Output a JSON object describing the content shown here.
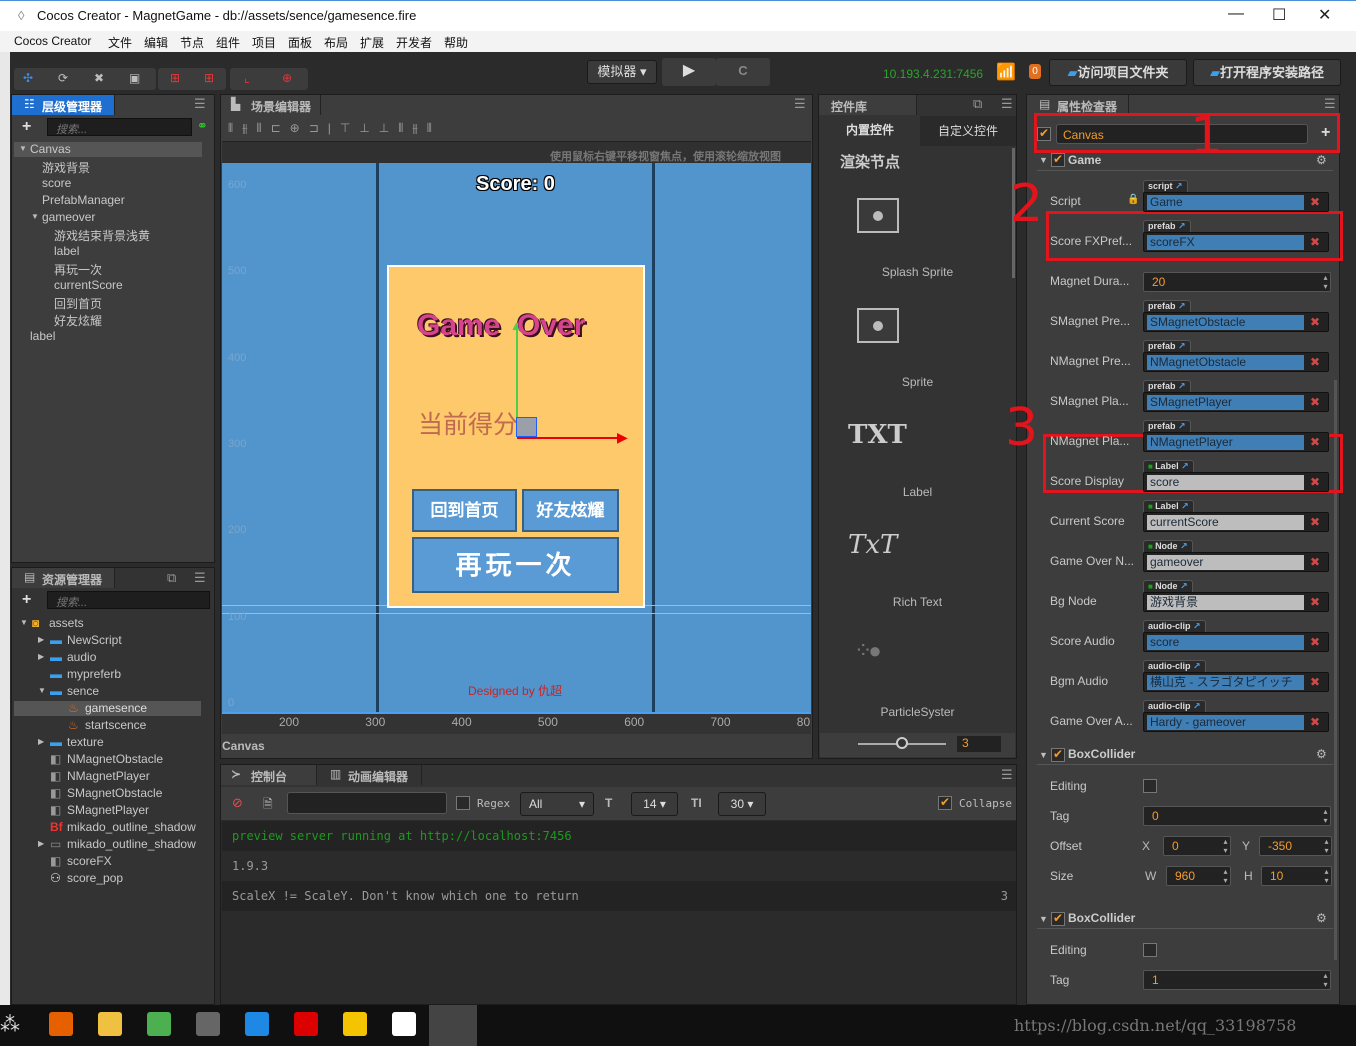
{
  "window": {
    "title": "Cocos Creator - MagnetGame - db://assets/sence/gamesence.fire",
    "minimize": "—",
    "maximize": "☐",
    "close": "✕"
  },
  "menu": [
    "Cocos Creator",
    "文件",
    "编辑",
    "节点",
    "组件",
    "项目",
    "面板",
    "布局",
    "扩展",
    "开发者",
    "帮助"
  ],
  "toolbar": {
    "simulator": "模拟器 ▾",
    "play": "▶",
    "refresh": "C",
    "ip": "10.193.4.231:7456",
    "badge": "0",
    "open_project": "访问项目文件夹",
    "open_install": "打开程序安装路径"
  },
  "hierarchy": {
    "title": "层级管理器",
    "search_placeholder": "搜索...",
    "items": [
      {
        "label": "Canvas",
        "depth": 0,
        "expanded": true
      },
      {
        "label": "游戏背景",
        "depth": 1
      },
      {
        "label": "score",
        "depth": 1
      },
      {
        "label": "PrefabManager",
        "depth": 1
      },
      {
        "label": "gameover",
        "depth": 1,
        "expanded": true
      },
      {
        "label": "游戏结束背景浅黄",
        "depth": 2
      },
      {
        "label": "label",
        "depth": 2
      },
      {
        "label": "再玩一次",
        "depth": 2
      },
      {
        "label": "currentScore",
        "depth": 2
      },
      {
        "label": "回到首页",
        "depth": 2
      },
      {
        "label": "好友炫耀",
        "depth": 2
      },
      {
        "label": "label",
        "depth": 0
      }
    ]
  },
  "assets": {
    "title": "资源管理器",
    "search_placeholder": "搜索...",
    "items": [
      {
        "label": "assets",
        "depth": 0,
        "icon": "assets-db-icon",
        "arrow": "down"
      },
      {
        "label": "NewScript",
        "depth": 1,
        "icon": "folder-icon",
        "arrow": "right"
      },
      {
        "label": "audio",
        "depth": 1,
        "icon": "folder-icon",
        "arrow": "right"
      },
      {
        "label": "mypreferb",
        "depth": 1,
        "icon": "folder-icon"
      },
      {
        "label": "sence",
        "depth": 1,
        "icon": "folder-icon",
        "arrow": "down"
      },
      {
        "label": "gamesence",
        "depth": 2,
        "icon": "scene-fire-icon",
        "selected": true
      },
      {
        "label": "startscence",
        "depth": 2,
        "icon": "scene-fire-icon"
      },
      {
        "label": "texture",
        "depth": 1,
        "icon": "folder-icon",
        "arrow": "right"
      },
      {
        "label": "NMagnetObstacle",
        "depth": 1,
        "icon": "prefab-icon"
      },
      {
        "label": "NMagnetPlayer",
        "depth": 1,
        "icon": "prefab-icon"
      },
      {
        "label": "SMagnetObstacle",
        "depth": 1,
        "icon": "prefab-icon"
      },
      {
        "label": "SMagnetPlayer",
        "depth": 1,
        "icon": "prefab-icon"
      },
      {
        "label": "mikado_outline_shadow",
        "depth": 1,
        "icon": "bitmap-font-icon"
      },
      {
        "label": "mikado_outline_shadow",
        "depth": 1,
        "icon": "texture-icon",
        "arrow": "right"
      },
      {
        "label": "scoreFX",
        "depth": 1,
        "icon": "prefab-icon"
      },
      {
        "label": "score_pop",
        "depth": 1,
        "icon": "animation-clip-icon"
      }
    ]
  },
  "scene": {
    "title": "场景编辑器",
    "hint": "使用鼠标右键平移视窗焦点，使用滚轮缩放视图",
    "score_text": "Score: 0",
    "game_over": "Game  Over",
    "current_score": "当前得分 :",
    "btn_home": "回到首页",
    "btn_share": "好友炫耀",
    "btn_replay": "再玩一次",
    "designed_by": "Designed by 仇超",
    "y_ticks": [
      "600",
      "500",
      "400",
      "300",
      "200",
      "100",
      "0"
    ],
    "x_ticks": [
      "200",
      "300",
      "400",
      "500",
      "600",
      "700",
      "80"
    ],
    "footer": "Canvas",
    "bg_color": "#5294cc",
    "panel_color": "#fdc96a"
  },
  "widgets": {
    "title": "控件库",
    "tab_builtin": "内置控件",
    "tab_custom": "自定义控件",
    "section": "渲染节点",
    "items": [
      "Splash Sprite",
      "Sprite",
      "Label",
      "Rich Text",
      "ParticleSyster"
    ],
    "label_glyph": "TXT",
    "richtext_glyph": "TxT",
    "zoom_value": "3",
    "zoom_fraction": 0.5
  },
  "console": {
    "tab_console": "控制台",
    "tab_anim": "动画编辑器",
    "regex": "Regex",
    "level": "All",
    "font_size": "14",
    "line_height": "30",
    "collapse": "Collapse",
    "collapse_checked": true,
    "lines": [
      {
        "text": "preview server running at http://localhost:7456",
        "color": "#1d9a1d"
      },
      {
        "text": "1.9.3"
      },
      {
        "text": "ScaleX != ScaleY. Don't know which one to return",
        "count": "3"
      }
    ]
  },
  "inspector": {
    "title": "属性检查器",
    "node_name": "Canvas",
    "component": "Game",
    "props": [
      {
        "label": "Script",
        "tag": "script",
        "value": "Game",
        "kind": "blue",
        "lock": true
      },
      {
        "label": "Score FXPref...",
        "tag": "prefab",
        "value": "scoreFX",
        "kind": "blue"
      },
      {
        "label": "Magnet Dura...",
        "value": "20",
        "kind": "number"
      },
      {
        "label": "SMagnet Pre...",
        "tag": "prefab",
        "value": "SMagnetObstacle",
        "kind": "blue"
      },
      {
        "label": "NMagnet Pre...",
        "tag": "prefab",
        "value": "NMagnetObstacle",
        "kind": "blue"
      },
      {
        "label": "SMagnet Pla...",
        "tag": "prefab",
        "value": "SMagnetPlayer",
        "kind": "blue"
      },
      {
        "label": "NMagnet Pla...",
        "tag": "prefab",
        "value": "NMagnetPlayer",
        "kind": "blue"
      },
      {
        "label": "Score Display",
        "tag": "Label",
        "value": "score",
        "kind": "gray",
        "dot": true
      },
      {
        "label": "Current Score",
        "tag": "Label",
        "value": "currentScore",
        "kind": "gray",
        "dot": true
      },
      {
        "label": "Game Over N...",
        "tag": "Node",
        "value": "gameover",
        "kind": "gray",
        "dot": true
      },
      {
        "label": "Bg Node",
        "tag": "Node",
        "value": "游戏背景",
        "kind": "gray",
        "dot": true
      },
      {
        "label": "Score Audio",
        "tag": "audio-clip",
        "value": "score",
        "kind": "blue"
      },
      {
        "label": "Bgm Audio",
        "tag": "audio-clip",
        "value": "横山克 - スラゴタピイッチ",
        "kind": "blue"
      },
      {
        "label": "Game Over A...",
        "tag": "audio-clip",
        "value": "Hardy - gameover",
        "kind": "blue"
      }
    ],
    "colliders": [
      {
        "title": "BoxCollider",
        "editing": "Editing",
        "tag_label": "Tag",
        "tag": "0",
        "offset": "Offset",
        "ox": "0",
        "oy": "-350",
        "size": "Size",
        "w": "960",
        "h": "10",
        "x_l": "X",
        "y_l": "Y",
        "w_l": "W",
        "h_l": "H"
      },
      {
        "title": "BoxCollider",
        "editing": "Editing",
        "tag_label": "Tag",
        "tag": "1"
      }
    ]
  },
  "annotations": [
    "1",
    "2",
    "3"
  ],
  "taskbar": {
    "watermark": "https://blog.csdn.net/qq_33198758",
    "apps": [
      "firefox-icon",
      "file-explorer-icon",
      "chrome-icon",
      "app-icon",
      "vscode-icon",
      "netease-music-icon",
      "app-icon-yellow",
      "baidu-netdisk-icon",
      "cocos-creator-icon"
    ]
  }
}
